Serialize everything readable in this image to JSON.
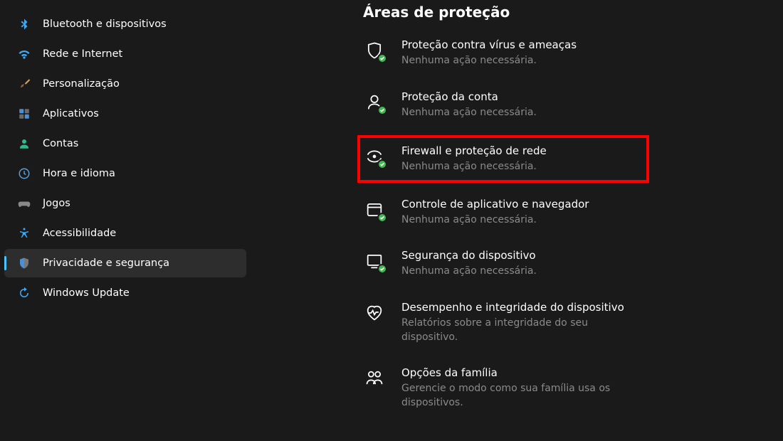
{
  "sidebar": {
    "items": [
      {
        "label": "Bluetooth e dispositivos"
      },
      {
        "label": "Rede e Internet"
      },
      {
        "label": "Personalização"
      },
      {
        "label": "Aplicativos"
      },
      {
        "label": "Contas"
      },
      {
        "label": "Hora e idioma"
      },
      {
        "label": "Jogos"
      },
      {
        "label": "Acessibilidade"
      },
      {
        "label": "Privacidade e segurança"
      },
      {
        "label": "Windows Update"
      }
    ]
  },
  "main": {
    "section_title": "Áreas de proteção",
    "items": [
      {
        "title": "Proteção contra vírus e ameaças",
        "desc": "Nenhuma ação necessária."
      },
      {
        "title": "Proteção da conta",
        "desc": "Nenhuma ação necessária."
      },
      {
        "title": "Firewall e proteção de rede",
        "desc": "Nenhuma ação necessária."
      },
      {
        "title": "Controle de aplicativo e navegador",
        "desc": "Nenhuma ação necessária."
      },
      {
        "title": "Segurança do dispositivo",
        "desc": "Nenhuma ação necessária."
      },
      {
        "title": "Desempenho e integridade do dispositivo",
        "desc": "Relatórios sobre a integridade do seu dispositivo."
      },
      {
        "title": "Opções da família",
        "desc": "Gerencie o modo como sua família usa os dispositivos."
      }
    ]
  }
}
